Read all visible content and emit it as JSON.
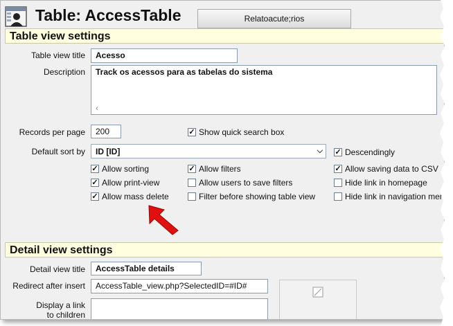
{
  "header": {
    "title": "Table: AccessTable",
    "reports_button": "Relatoacute;rios"
  },
  "table_view": {
    "section_title": "Table view settings",
    "title_label": "Table view title",
    "title_value": "Acesso",
    "description_label": "Description",
    "description_value": "Track os acessos para as tabelas do sistema",
    "records_label": "Records per page",
    "records_value": "200",
    "quick_search": "Show quick search box",
    "sort_label": "Default sort by",
    "sort_value": "ID [ID]",
    "descending": "Descendingly",
    "options": {
      "allow_sorting": "Allow sorting",
      "allow_filters": "Allow filters",
      "allow_saving_csv": "Allow saving data to CSV",
      "allow_print_view": "Allow print-view",
      "allow_users_save_filters": "Allow users to save filters",
      "hide_link_homepage": "Hide link in homepage",
      "allow_mass_delete": "Allow mass delete",
      "filter_before_show": "Filter before showing table view",
      "hide_link_nav": "Hide link in navigation menu"
    }
  },
  "detail_view": {
    "section_title": "Detail view settings",
    "title_label": "Detail view title",
    "title_value": "AccessTable details",
    "redirect_label": "Redirect after insert",
    "redirect_value": "AccessTable_view.php?SelectedID=#ID#",
    "display_link_label": "Display a link\nto children"
  }
}
